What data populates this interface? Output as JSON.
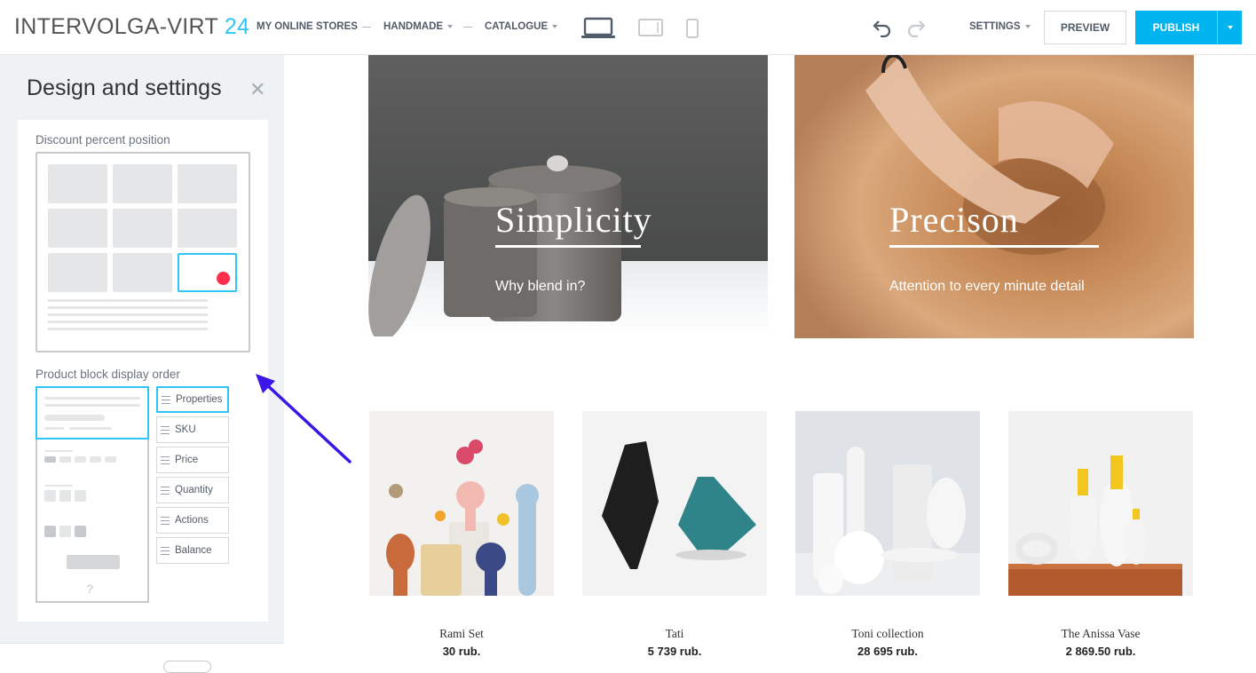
{
  "app": {
    "name": "INTERVOLGA-VIRT",
    "name_suffix": "24"
  },
  "nav": [
    {
      "label": "MY ONLINE STORES"
    },
    {
      "label": "HANDMADE"
    },
    {
      "label": "CATALOGUE"
    }
  ],
  "devices": [
    "laptop-icon",
    "tablet-icon",
    "phone-icon"
  ],
  "toolbar": {
    "settings_label": "SETTINGS",
    "preview_label": "PREVIEW",
    "publish_label": "PUBLISH"
  },
  "panel": {
    "title": "Design and settings",
    "discount_label": "Discount percent position",
    "order_label": "Product block display order",
    "order_items": [
      {
        "label": "Properties",
        "active": true
      },
      {
        "label": "SKU"
      },
      {
        "label": "Price"
      },
      {
        "label": "Quantity"
      },
      {
        "label": "Actions"
      },
      {
        "label": "Balance"
      }
    ],
    "order_question_mark": "?"
  },
  "banners": [
    {
      "title": "Simplicity",
      "subtitle": "Why blend in?"
    },
    {
      "title": "Precison",
      "subtitle": "Attention to every minute detail"
    }
  ],
  "products": [
    {
      "name": "Rami Set",
      "price": "30 rub."
    },
    {
      "name": "Tati",
      "price": "5 739 rub."
    },
    {
      "name": "Toni collection",
      "price": "28 695 rub."
    },
    {
      "name": "The Anissa Vase",
      "price": "2 869.50 rub."
    }
  ],
  "colors": {
    "accent": "#2fc6f6",
    "publish": "#00b4f0",
    "discount_dot": "#ff2e4c",
    "annotation_arrow": "#3b16e6"
  }
}
